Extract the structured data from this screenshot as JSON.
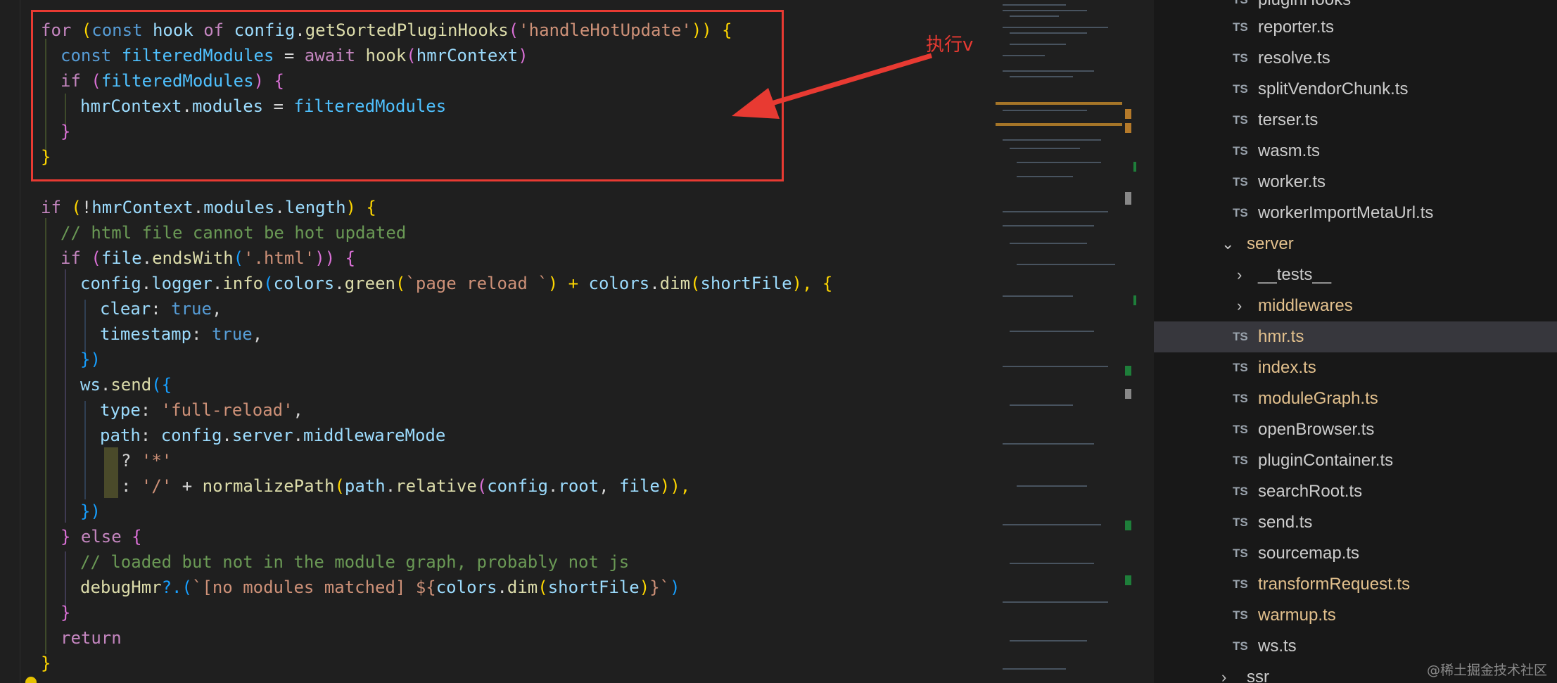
{
  "annotation": {
    "text": "执行vite插件中自定义的热更新逻辑",
    "box_color": "#e83a32",
    "arrow_color": "#e83a32"
  },
  "code": {
    "l1": {
      "a": "for",
      "b": " (",
      "c": "const",
      "d": " hook ",
      "e": "of",
      "f": " config",
      "g": ".",
      "h": "getSortedPluginHooks",
      "i": "(",
      "j": "'handleHotUpdate'",
      "k": ")) {"
    },
    "l2": {
      "a": "const",
      "b": " filteredModules ",
      "c": "=",
      "d": " await ",
      "e": "hook",
      "f": "(",
      "g": "hmrContext",
      "h": ")"
    },
    "l3": {
      "a": "if",
      "b": " (",
      "c": "filteredModules",
      "d": ") {"
    },
    "l4": {
      "a": "hmrContext",
      "b": ".",
      "c": "modules",
      "d": " = ",
      "e": "filteredModules"
    },
    "l5": {
      "a": "}"
    },
    "l6": {
      "a": "}"
    },
    "l7": {
      "a": "if",
      "b": " (",
      "c": "!",
      "d": "hmrContext",
      "e": ".",
      "f": "modules",
      "g": ".",
      "h": "length",
      "i": ") {"
    },
    "l8": {
      "a": "// html file cannot be hot updated"
    },
    "l9": {
      "a": "if",
      "b": " (",
      "c": "file",
      "d": ".",
      "e": "endsWith",
      "f": "(",
      "g": "'.html'",
      "h": ")) {"
    },
    "l10": {
      "a": "config",
      "b": ".",
      "c": "logger",
      "d": ".",
      "e": "info",
      "f": "(",
      "g": "colors",
      "h": ".",
      "i": "green",
      "j": "(",
      "k": "`page reload `",
      "l": ") + ",
      "m": "colors",
      "n": ".",
      "o": "dim",
      "p": "(",
      "q": "shortFile",
      "r": "), {"
    },
    "l11": {
      "a": "clear",
      "b": ": ",
      "c": "true",
      "d": ","
    },
    "l12": {
      "a": "timestamp",
      "b": ": ",
      "c": "true",
      "d": ","
    },
    "l13": {
      "a": "})"
    },
    "l14": {
      "a": "ws",
      "b": ".",
      "c": "send",
      "d": "({"
    },
    "l15": {
      "a": "type",
      "b": ": ",
      "c": "'full-reload'",
      "d": ","
    },
    "l16": {
      "a": "path",
      "b": ": ",
      "c": "config",
      "d": ".",
      "e": "server",
      "f": ".",
      "g": "middlewareMode"
    },
    "l17": {
      "a": "? ",
      "b": "'*'"
    },
    "l18": {
      "a": ": ",
      "b": "'/'",
      "c": " + ",
      "d": "normalizePath",
      "e": "(",
      "f": "path",
      "g": ".",
      "h": "relative",
      "i": "(",
      "j": "config",
      "k": ".",
      "l": "root",
      "m": ", ",
      "n": "file",
      "o": ")),"
    },
    "l19": {
      "a": "})"
    },
    "l20": {
      "a": "} ",
      "b": "else",
      "c": " {"
    },
    "l21": {
      "a": "// loaded but not in the module graph, probably not js"
    },
    "l22": {
      "a": "debugHmr",
      "b": "?.(",
      "c": "`[no modules matched] ${",
      "d": "colors",
      "e": ".",
      "f": "dim",
      "g": "(",
      "h": "shortFile",
      "i": ")",
      "j": "}`",
      "k": ")"
    },
    "l23": {
      "a": "}"
    },
    "l24": {
      "a": "return"
    },
    "l25": {
      "a": "}"
    }
  },
  "explorer": {
    "partial_top": "pluginHooks",
    "items": [
      {
        "label": "reporter.ts",
        "badge": "TS"
      },
      {
        "label": "resolve.ts",
        "badge": "TS"
      },
      {
        "label": "splitVendorChunk.ts",
        "badge": "TS"
      },
      {
        "label": "terser.ts",
        "badge": "TS"
      },
      {
        "label": "wasm.ts",
        "badge": "TS"
      },
      {
        "label": "worker.ts",
        "badge": "TS"
      },
      {
        "label": "workerImportMetaUrl.ts",
        "badge": "TS"
      }
    ],
    "folder_server": "server",
    "folder_tests": "__tests__",
    "folder_middlewares": "middlewares",
    "server_items": [
      {
        "label": "hmr.ts",
        "badge": "TS"
      },
      {
        "label": "index.ts",
        "badge": "TS"
      },
      {
        "label": "moduleGraph.ts",
        "badge": "TS"
      },
      {
        "label": "openBrowser.ts",
        "badge": "TS"
      },
      {
        "label": "pluginContainer.ts",
        "badge": "TS"
      },
      {
        "label": "searchRoot.ts",
        "badge": "TS"
      },
      {
        "label": "send.ts",
        "badge": "TS"
      },
      {
        "label": "sourcemap.ts",
        "badge": "TS"
      },
      {
        "label": "transformRequest.ts",
        "badge": "TS"
      },
      {
        "label": "warmup.ts",
        "badge": "TS"
      },
      {
        "label": "ws.ts",
        "badge": "TS"
      }
    ],
    "folder_ssr": "ssr"
  },
  "watermark": "@稀土掘金技术社区"
}
